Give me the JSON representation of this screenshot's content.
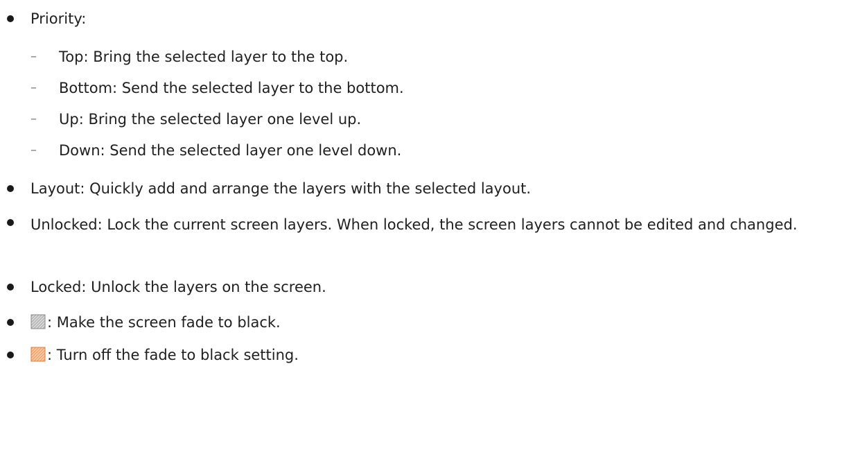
{
  "list": {
    "priority": {
      "label": "Priority:",
      "items": [
        "Top: Bring the selected layer to the top.",
        "Bottom: Send the selected layer to the bottom.",
        "Up: Bring the selected layer one level up.",
        "Down: Send the selected layer one level down."
      ],
      "dash": "–"
    },
    "layout": "Layout: Quickly add and arrange the layers with the selected layout.",
    "unlocked": "Unlocked: Lock the current screen layers. When locked, the screen layers cannot be edited and changed.",
    "locked": "Locked: Unlock the layers on the screen.",
    "fade_black": {
      "icon": "gray-hatched-square-icon",
      "text": ": Make the screen fade to black."
    },
    "fade_off": {
      "icon": "orange-hatched-square-icon",
      "text": ": Turn off the fade to black setting."
    }
  },
  "colors": {
    "gray_icon": "#9a9a9a",
    "orange_icon": "#f08a4b"
  }
}
